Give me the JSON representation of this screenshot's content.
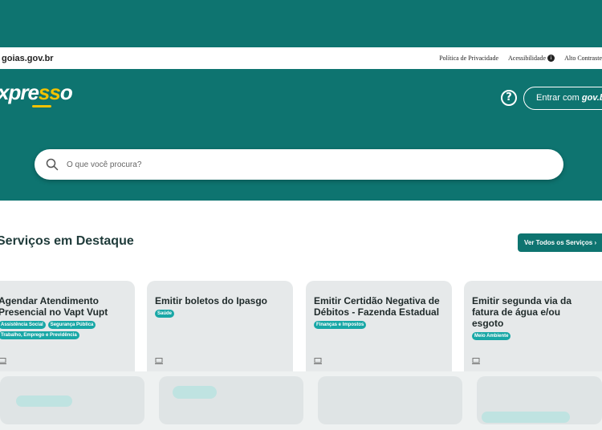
{
  "gov_bar": {
    "site": "goias.gov.br",
    "links": [
      "Política de Privacidade",
      "Acessibilidade",
      "Alto Contraste"
    ],
    "accessibility_icon": "info-icon"
  },
  "header": {
    "logo_text_pre": "xpre",
    "logo_text_accent": "ss",
    "logo_text_post": "o",
    "help_icon": "help-icon",
    "login_label": "Entrar com ",
    "login_brand": "gov.br"
  },
  "search": {
    "placeholder": "O que você procura?",
    "icon": "search-icon"
  },
  "section": {
    "title": "Serviços em Destaque",
    "see_all_label": "Ver Todos os Serviços",
    "see_all_icon": "chevron-right-icon"
  },
  "cards": [
    {
      "title": "Agendar Atendimento Presencial no Vapt Vupt",
      "tags": [
        "Assistência Social",
        "Segurança Pública",
        "Trabalho, Emprego e Previdência"
      ],
      "icon": "computer-icon"
    },
    {
      "title": "Emitir boletos do Ipasgo",
      "tags": [
        "Saúde"
      ],
      "icon": "computer-icon"
    },
    {
      "title": "Emitir Certidão Negativa de Débitos - Fazenda Estadual",
      "tags": [
        "Finanças e Impostos"
      ],
      "icon": "computer-icon"
    },
    {
      "title": "Emitir segunda via da fatura de água e/ou esgoto",
      "tags": [
        "Meio Ambiente"
      ],
      "icon": "computer-icon"
    }
  ],
  "colors": {
    "brand": "#0e7470",
    "accent": "#f2c200",
    "tag": "#18a7a6"
  }
}
